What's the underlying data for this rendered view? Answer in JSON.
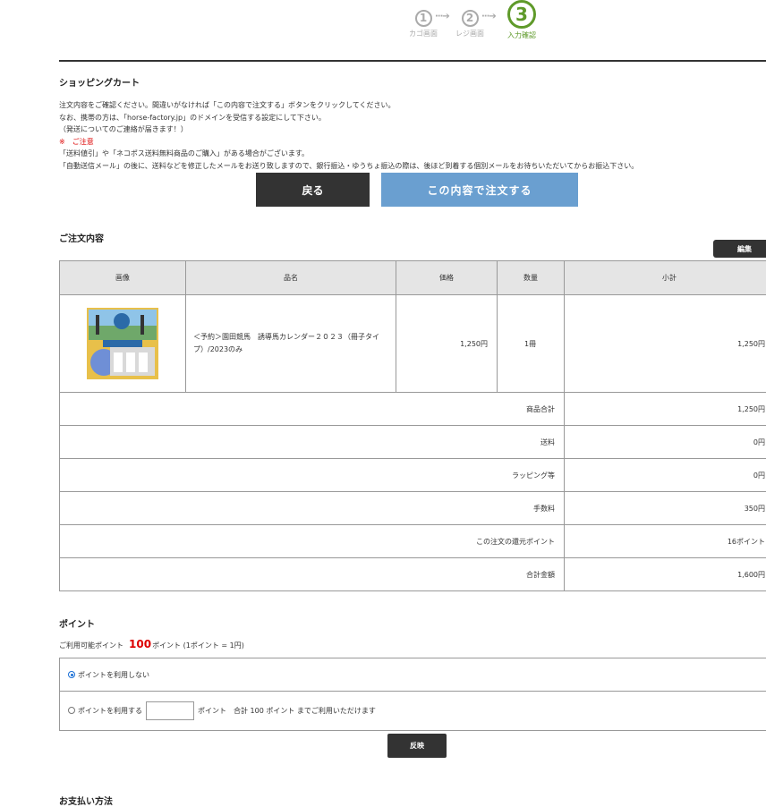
{
  "steps": [
    {
      "num": "①",
      "label": "カゴ画面"
    },
    {
      "num": "②",
      "label": "レジ画面"
    },
    {
      "num": "③",
      "label": "入力確認"
    }
  ],
  "cart": {
    "title": "ショッピングカート",
    "notice": [
      "注文内容をご確認ください。間違いがなければ「この内容で注文する」ボタンをクリックしてください。",
      "なお、携帯の方は、「horse-factory.jp」のドメインを受信する設定にして下さい。",
      "（発送についてのご連絡が届きます！）",
      "※　ご注意",
      "「送料値引」や「ネコポス送料無料商品のご購入」がある場合がございます。",
      "「自動送信メール」の後に、送料などを修正したメールをお送り致しますので、銀行振込・ゆうちょ振込の際は、後ほど到着する個別メールをお待ちいただいてからお振込下さい。"
    ],
    "back_label": "戻る",
    "order_label": "この内容で注文する"
  },
  "order": {
    "title": "ご注文内容",
    "edit_label": "編集",
    "headers": [
      "画像",
      "品名",
      "価格",
      "数量",
      "小計"
    ],
    "item": {
      "name": "＜予約＞園田競馬　誘導馬カレンダー２０２３（冊子タイプ）/2023のみ",
      "price": "1,250円",
      "qty": "1冊",
      "subtotal": "1,250円"
    },
    "summary": [
      {
        "label": "商品合計",
        "value": "1,250円"
      },
      {
        "label": "送料",
        "value": "0円"
      },
      {
        "label": "ラッピング等",
        "value": "0円"
      },
      {
        "label": "手数料",
        "value": "350円"
      },
      {
        "label": "この注文の還元ポイント",
        "value": "16ポイント"
      },
      {
        "label": "合計金額",
        "value": "1,600円"
      }
    ]
  },
  "points": {
    "title": "ポイント",
    "available_prefix": "ご利用可能ポイント",
    "available_value": "100",
    "available_suffix": "ポイント (1ポイント = 1円)",
    "option_none": "ポイントを利用しない",
    "option_use": "ポイントを利用する",
    "use_suffix": "ポイント　合計 100 ポイント までご利用いただけます",
    "apply_label": "反映"
  },
  "next_section_title": "お支払い方法"
}
